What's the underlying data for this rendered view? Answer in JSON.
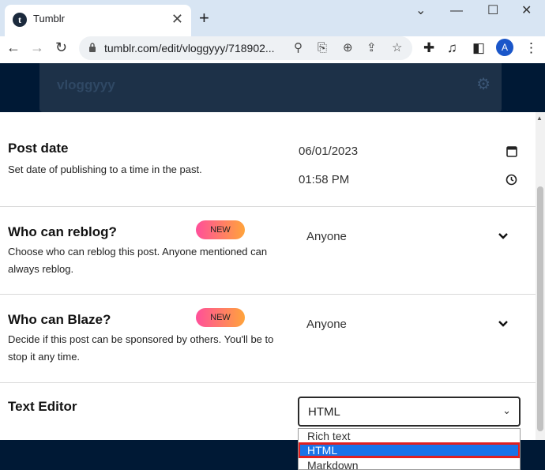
{
  "browser": {
    "tab_title": "Tumblr",
    "tab_favicon": "t",
    "url": "tumblr.com/edit/vloggyyy/718902...",
    "avatar_letter": "A"
  },
  "header": {
    "blog_name": "vloggyyy"
  },
  "post_date": {
    "title": "Post date",
    "description": "Set date of publishing to a time in the past.",
    "date": "06/01/2023",
    "time": "01:58 PM"
  },
  "reblog": {
    "title": "Who can reblog?",
    "badge": "NEW",
    "description": "Choose who can reblog this post. Anyone mentioned can always reblog.",
    "value": "Anyone"
  },
  "blaze": {
    "title": "Who can Blaze?",
    "badge": "NEW",
    "description": "Decide if this post can be sponsored by others. You'll be to stop it any time.",
    "value": "Anyone"
  },
  "text_editor": {
    "title": "Text Editor",
    "value": "HTML",
    "options": [
      "Rich text",
      "HTML",
      "Markdown"
    ]
  },
  "colors": {
    "navy": "#001935",
    "badge_start": "#ff4f9a",
    "badge_end": "#ffa43b",
    "selected_option": "#1a73e8",
    "highlight_box": "#e02020"
  }
}
